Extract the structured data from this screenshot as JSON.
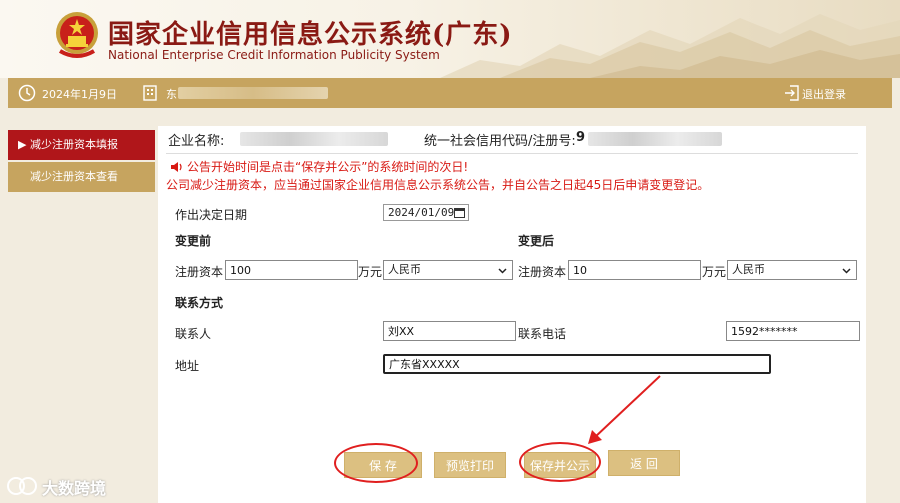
{
  "header": {
    "title_cn": "国家企业信用信息公示系统(广东)",
    "title_en": "National Enterprise Credit Information Publicity System"
  },
  "topbar": {
    "date": "2024年1月9日",
    "user_initial": "东",
    "logout_label": "退出登录"
  },
  "sidebar": {
    "items": [
      {
        "label": "▶ 减少注册资本填报",
        "active": true
      },
      {
        "label": "减少注册资本查看",
        "active": false
      }
    ]
  },
  "company": {
    "name_label": "企业名称:",
    "code_label": "统一社会信用代码/注册号:",
    "code_prefix": "9"
  },
  "notices": {
    "line1": "公告开始时间是点击“保存并公示”的系统时间的次日!",
    "line2": "公司减少注册资本，应当通过国家企业信用信息公示系统公告，并自公告之日起45日后申请变更登记。"
  },
  "form": {
    "decision_date_label": "作出决定日期",
    "decision_date_value": "2024/01/09",
    "before_heading": "变更前",
    "after_heading": "变更后",
    "capital_label": "注册资本",
    "unit_label": "万元",
    "before_capital": "100",
    "after_capital": "10",
    "currency_before": "人民币",
    "currency_after": "人民币",
    "contact_heading": "联系方式",
    "contact_person_label": "联系人",
    "contact_person_value": "刘XX",
    "phone_label": "联系电话",
    "phone_value": "1592*******",
    "address_label": "地址",
    "address_value": "广东省XXXXX"
  },
  "buttons": {
    "save": "保 存",
    "preview": "预览打印",
    "save_publish": "保存并公示",
    "back": "返 回"
  },
  "watermark": "大数跨境",
  "colors": {
    "brand_red": "#8a1a14",
    "gold_bar": "#c6a45f",
    "active_red": "#b0161a",
    "notice_red": "#d81a14",
    "annotation_red": "#e01f1f"
  }
}
